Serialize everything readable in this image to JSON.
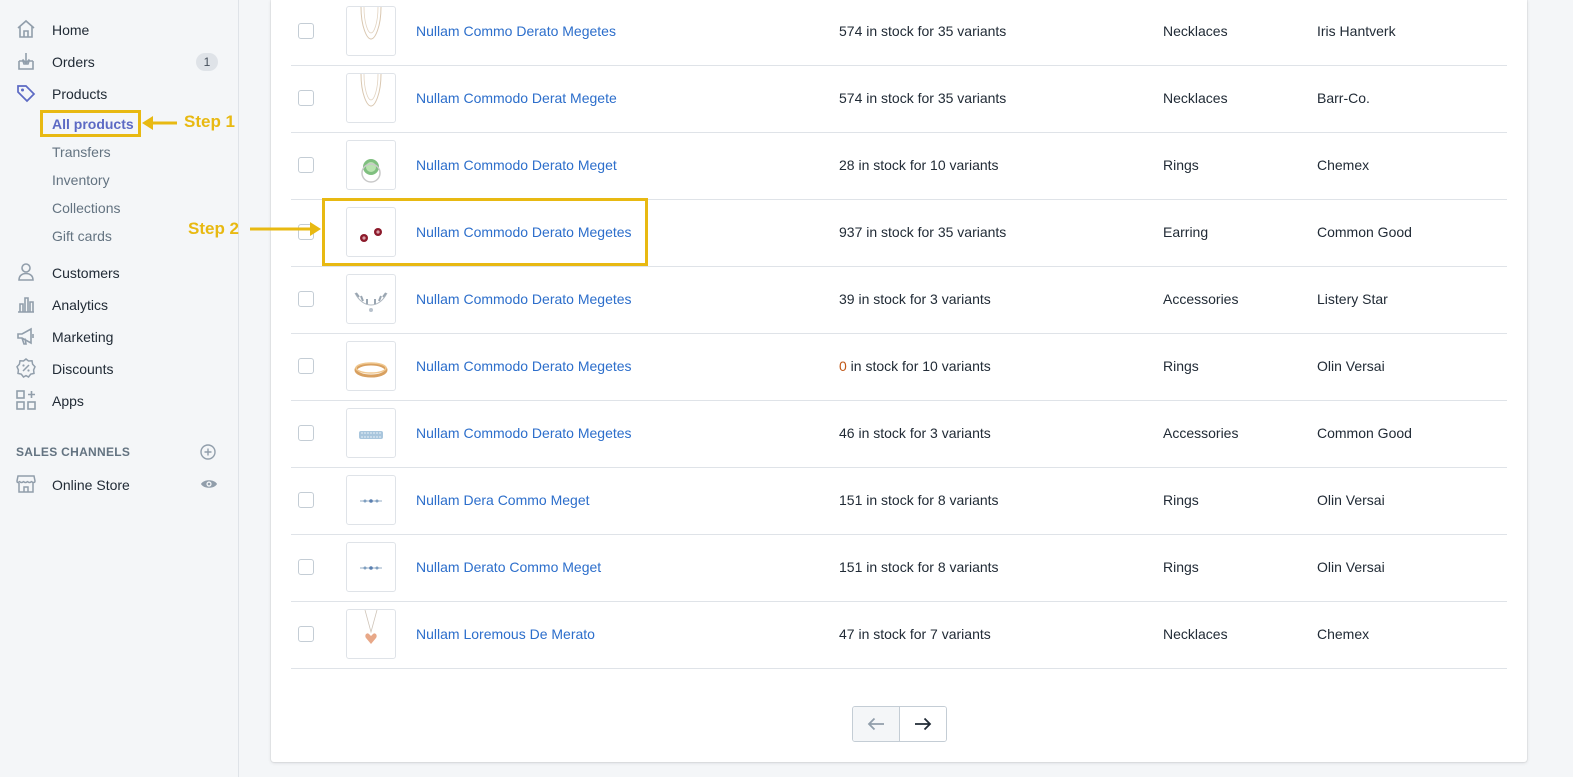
{
  "sidebar": {
    "nav": [
      {
        "label": "Home",
        "icon": "home-icon"
      },
      {
        "label": "Orders",
        "icon": "orders-icon",
        "badge": "1"
      },
      {
        "label": "Products",
        "icon": "tag-icon"
      }
    ],
    "product_subitems": [
      {
        "label": "All products",
        "active": true
      },
      {
        "label": "Transfers"
      },
      {
        "label": "Inventory"
      },
      {
        "label": "Collections"
      },
      {
        "label": "Gift cards"
      }
    ],
    "nav2": [
      {
        "label": "Customers",
        "icon": "person-icon"
      },
      {
        "label": "Analytics",
        "icon": "bar-chart-icon"
      },
      {
        "label": "Marketing",
        "icon": "megaphone-icon"
      },
      {
        "label": "Discounts",
        "icon": "discount-icon"
      },
      {
        "label": "Apps",
        "icon": "apps-icon"
      }
    ],
    "sales_channels_title": "SALES CHANNELS",
    "online_store_label": "Online Store"
  },
  "products": {
    "rows": [
      {
        "name": "Nullam Commo Derato Megetes",
        "stock_count": "574",
        "stock_rest": " in stock for 35 variants",
        "type": "Necklaces",
        "vendor": "Iris Hantverk",
        "thumb": "necklace"
      },
      {
        "name": "Nullam Commodo Derat Megete",
        "stock_count": "574",
        "stock_rest": " in stock for 35 variants",
        "type": "Necklaces",
        "vendor": "Barr-Co.",
        "thumb": "necklace"
      },
      {
        "name": "Nullam Commodo Derato Meget",
        "stock_count": "28",
        "stock_rest": " in stock for 10 variants",
        "type": "Rings",
        "vendor": "Chemex",
        "thumb": "green-ring"
      },
      {
        "name": "Nullam Commodo Derato Megetes",
        "stock_count": "937",
        "stock_rest": " in stock for 35 variants",
        "type": "Earring",
        "vendor": "Common Good",
        "thumb": "earrings"
      },
      {
        "name": "Nullam Commodo Derato Megetes",
        "stock_count": "39",
        "stock_rest": " in stock for 3 variants",
        "type": "Accessories",
        "vendor": "Listery Star",
        "thumb": "leaf"
      },
      {
        "name": "Nullam Commodo Derato Megetes",
        "stock_count": "0",
        "stock_rest": " in stock for 10 variants",
        "type": "Rings",
        "vendor": "Olin Versai",
        "thumb": "gold-band",
        "zero": true
      },
      {
        "name": "Nullam Commodo Derato Megetes",
        "stock_count": "46",
        "stock_rest": " in stock for 3 variants",
        "type": "Accessories",
        "vendor": "Common Good",
        "thumb": "blue-band"
      },
      {
        "name": "Nullam Dera Commo Meget",
        "stock_count": "151",
        "stock_rest": " in stock for 8 variants",
        "type": "Rings",
        "vendor": "Olin Versai",
        "thumb": "thin-ring"
      },
      {
        "name": "Nullam Derato Commo Meget",
        "stock_count": "151",
        "stock_rest": " in stock for 8 variants",
        "type": "Rings",
        "vendor": "Olin Versai",
        "thumb": "thin-ring"
      },
      {
        "name": "Nullam Loremous De Merato",
        "stock_count": "47",
        "stock_rest": " in stock for 7 variants",
        "type": "Necklaces",
        "vendor": "Chemex",
        "thumb": "heart-pendant"
      }
    ]
  },
  "annotations": {
    "step1": "Step 1",
    "step2": "Step 2",
    "color": "#e8b912"
  },
  "colors": {
    "link": "#2c6ecb",
    "active_nav": "#5c6ac4",
    "zero_stock": "#c05717"
  }
}
